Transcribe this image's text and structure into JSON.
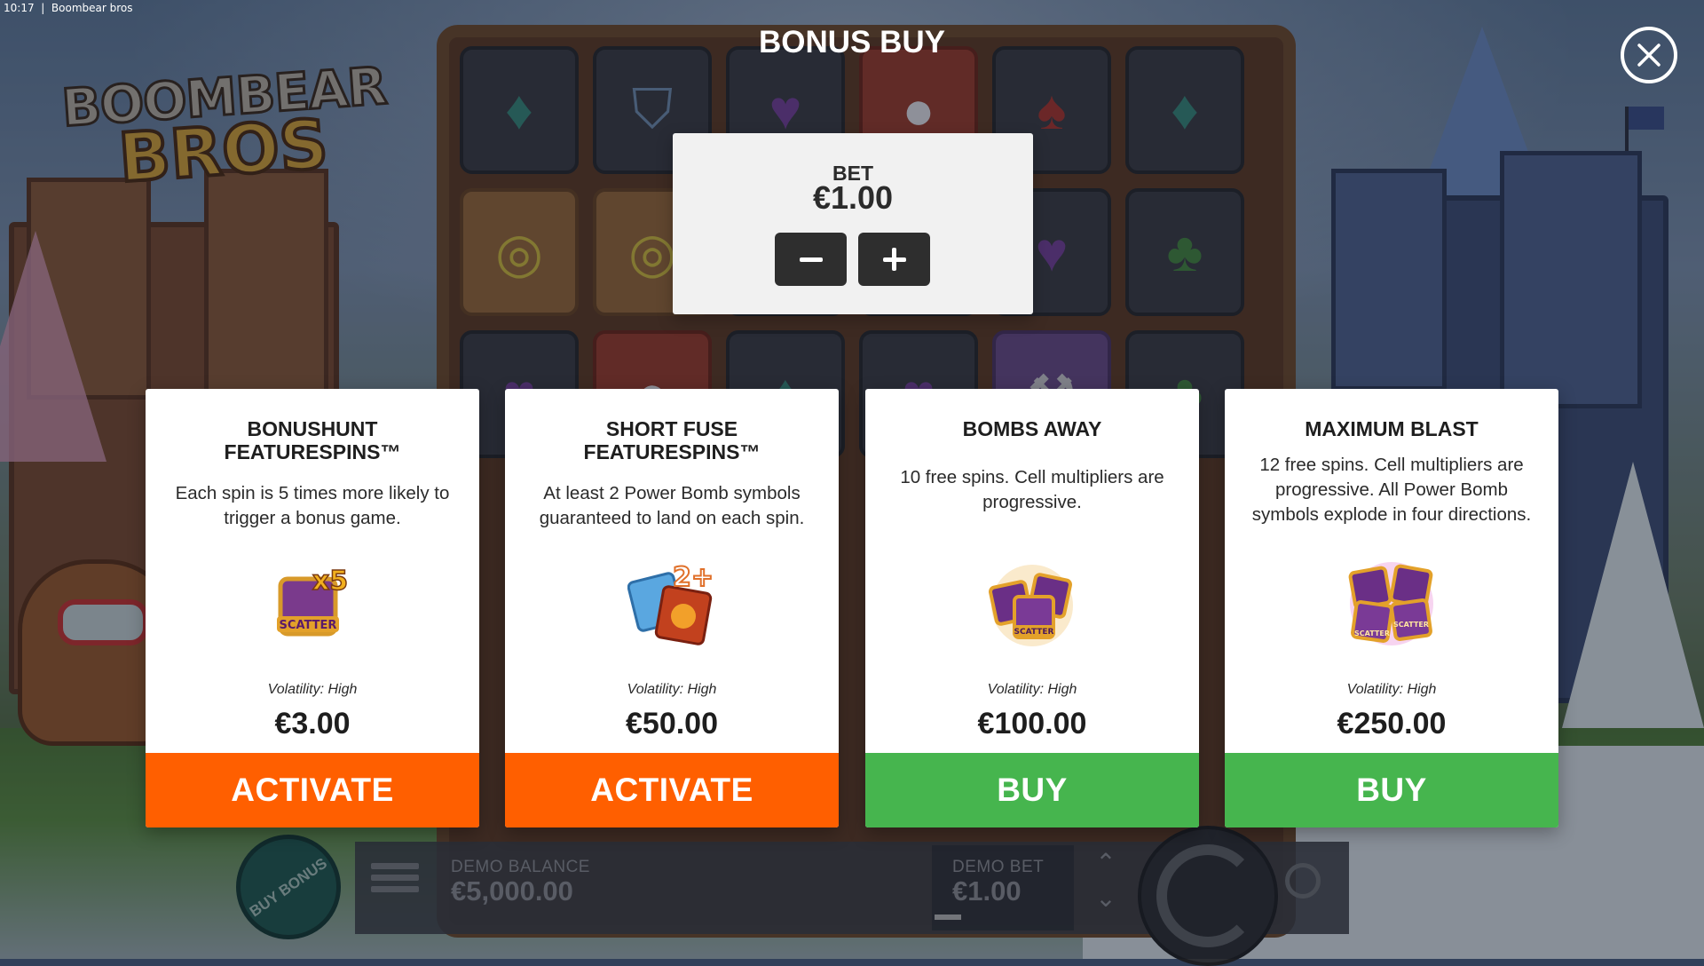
{
  "window": {
    "time": "10:17",
    "title": "Boombear bros"
  },
  "game": {
    "logo_line1": "BOOMBEAR",
    "logo_line2": "BROS"
  },
  "modal": {
    "title": "BONUS BUY",
    "bet": {
      "label": "BET",
      "value": "€1.00"
    },
    "cards": [
      {
        "title": "BONUSHUNT\nFEATURESPINS™",
        "description": "Each spin is 5 times more likely to trigger a bonus game.",
        "icon": "scatter-x5-icon",
        "volatility": "Volatility: High",
        "price": "€3.00",
        "button": "ACTIVATE"
      },
      {
        "title": "SHORT FUSE\nFEATURESPINS™",
        "description": "At least 2 Power Bomb symbols guaranteed to land on each spin.",
        "icon": "power-bomb-2plus-icon",
        "volatility": "Volatility: High",
        "price": "€50.00",
        "button": "ACTIVATE"
      },
      {
        "title": "BOMBS AWAY",
        "description": "10 free spins. Cell multipliers are progressive.",
        "icon": "scatter-three-icon",
        "volatility": "Volatility: High",
        "price": "€100.00",
        "button": "BUY"
      },
      {
        "title": "MAXIMUM BLAST",
        "description": "12 free spins. Cell multipliers are progressive. All Power Bomb symbols explode in four directions.",
        "icon": "scatter-four-icon",
        "volatility": "Volatility: High",
        "price": "€250.00",
        "button": "BUY"
      }
    ]
  },
  "controls": {
    "buy_bonus": "BUY BONUS",
    "demo_balance_label": "DEMO BALANCE",
    "demo_balance_value": "€5,000.00",
    "demo_bet_label": "DEMO BET",
    "demo_bet_value": "€1.00"
  },
  "colors": {
    "activate": "#ff5f00",
    "buy": "#46b54e",
    "card_bg": "#ffffff",
    "bet_panel_bg": "#f1f1f1"
  }
}
